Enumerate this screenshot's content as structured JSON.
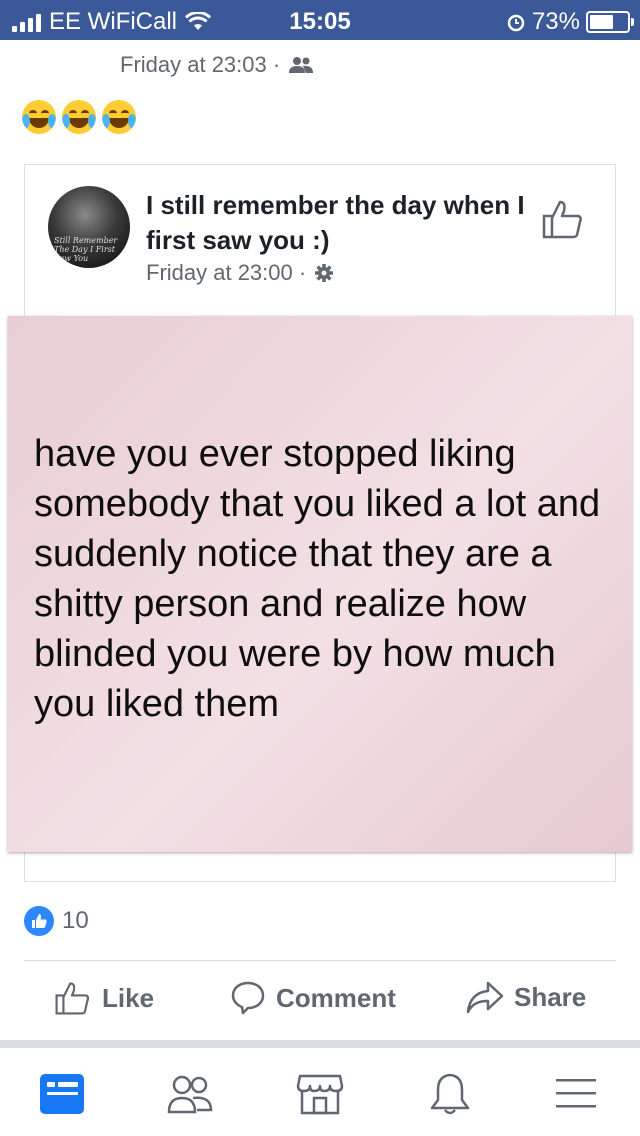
{
  "status_bar": {
    "carrier": "EE WiFiCall",
    "time": "15:05",
    "battery": "73%",
    "battery_level": 0.73
  },
  "prev_post": {
    "meta": "Friday at 23:03 ·",
    "audience_icon": "friends-icon"
  },
  "comment": {
    "emoji_count": 3,
    "emoji_name": "laughing-tears-emoji"
  },
  "shared_post": {
    "title": "I still remember the day when I first saw you  :)",
    "meta": "Friday at 23:00 ·",
    "privacy_icon": "gear-icon",
    "avatar_caption": "Still Remember The Day I First Saw You",
    "image_text": "have you ever stopped liking somebody that you liked a lot and suddenly notice that they are a shitty person and realize how blinded you were by how much you liked them"
  },
  "reactions": {
    "count": "10",
    "icon": "like-icon"
  },
  "actions": {
    "like": "Like",
    "comment": "Comment",
    "share": "Share"
  },
  "nav": {
    "items": [
      "news-feed-icon",
      "friends-icon",
      "marketplace-icon",
      "notifications-icon",
      "menu-icon"
    ],
    "active": "news-feed-icon"
  },
  "colors": {
    "brand": "#3b5998",
    "like_blue": "#2d88ff",
    "muted": "#606770",
    "active_nav": "#1877f2"
  }
}
